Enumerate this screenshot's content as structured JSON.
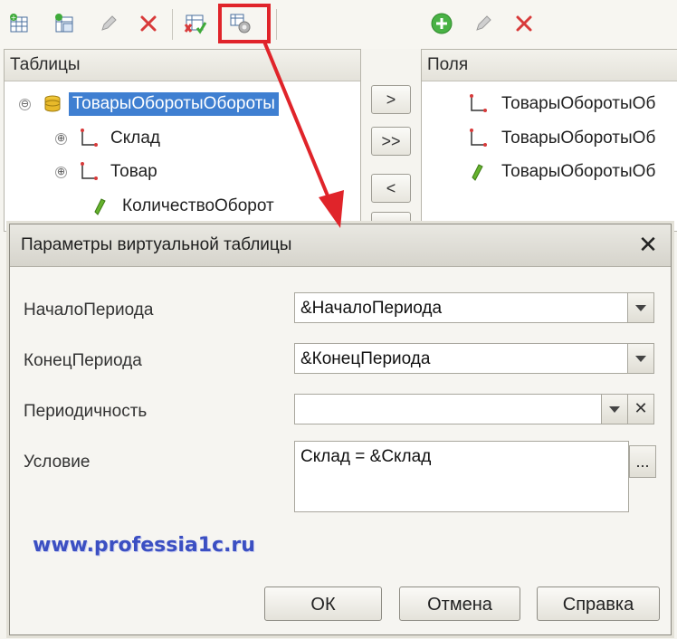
{
  "toolbar_left": {
    "icons": [
      "add-table-icon",
      "add-nested-table-icon",
      "edit-pencil-icon",
      "delete-x-icon",
      "replace-table-icon",
      "virtual-table-parameters-icon"
    ]
  },
  "toolbar_right": {
    "icons": [
      "add-green-plus-icon",
      "edit-pencil-icon",
      "delete-x-icon"
    ]
  },
  "tables_panel": {
    "header": "Таблицы",
    "items": [
      {
        "label": "ТоварыОборотыОбороты",
        "expander": "⊖",
        "icon": "register-db-icon",
        "selected": true
      },
      {
        "label": "Склад",
        "expander": "⊕",
        "icon": "dimension-icon"
      },
      {
        "label": "Товар",
        "expander": "⊕",
        "icon": "dimension-icon"
      },
      {
        "label": "КоличествоОборот",
        "expander": "",
        "icon": "resource-icon"
      }
    ]
  },
  "move_buttons": {
    "add": ">",
    "add_all": ">>",
    "remove": "<"
  },
  "fields_panel": {
    "header": "Поля",
    "items": [
      {
        "label": "ТоварыОборотыОб",
        "icon": "dimension-icon"
      },
      {
        "label": "ТоварыОборотыОб",
        "icon": "dimension-icon"
      },
      {
        "label": "ТоварыОборотыОб",
        "icon": "resource-icon"
      }
    ]
  },
  "dialog": {
    "title": "Параметры виртуальной таблицы",
    "close": "✕",
    "fields": [
      {
        "label": "НачалоПериода",
        "value": "&НачалоПериода"
      },
      {
        "label": "КонецПериода",
        "value": "&КонецПериода"
      },
      {
        "label": "Периодичность",
        "value": ""
      },
      {
        "label": "Условие",
        "value": "Склад = &Склад"
      }
    ],
    "ellipsis": "...",
    "clear": "✕",
    "watermark": "www.professia1c.ru",
    "buttons": {
      "ok": "ОК",
      "cancel": "Отмена",
      "help": "Справка"
    }
  },
  "colors": {
    "highlight": "#e0242a",
    "selection": "#3f7fd1",
    "watermark": "#3b4fc2"
  }
}
